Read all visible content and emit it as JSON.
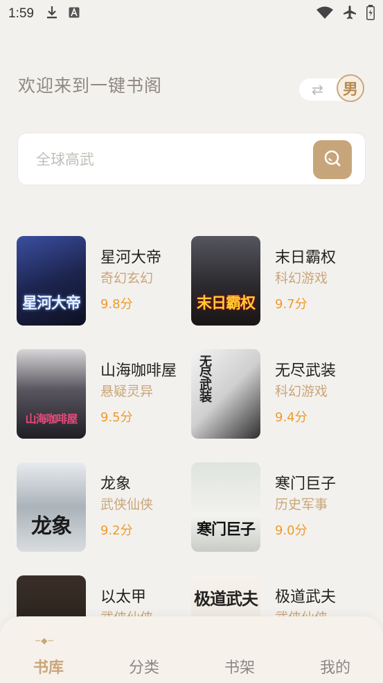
{
  "status_bar": {
    "time": "1:59"
  },
  "header": {
    "welcome": "欢迎来到一键书阁",
    "gender_label": "男",
    "swap_icon": "swap-arrows-icon"
  },
  "search": {
    "placeholder": "全球高武"
  },
  "books": [
    {
      "title": "星河大帝",
      "genre": "奇幻玄幻",
      "score": "9.8分",
      "cover_color": "#1d2550"
    },
    {
      "title": "末日霸权",
      "genre": "科幻游戏",
      "score": "9.7分",
      "cover_color": "#2b2a2e"
    },
    {
      "title": "山海咖啡屋",
      "genre": "悬疑灵异",
      "score": "9.5分",
      "cover_color": "#2e2e34"
    },
    {
      "title": "无尽武装",
      "genre": "科幻游戏",
      "score": "9.4分",
      "cover_color": "#d9d9d9"
    },
    {
      "title": "龙象",
      "genre": "武侠仙侠",
      "score": "9.2分",
      "cover_color": "#c9ced2"
    },
    {
      "title": "寒门巨子",
      "genre": "历史军事",
      "score": "9.0分",
      "cover_color": "#e3e6e2"
    },
    {
      "title": "以太甲",
      "genre": "武侠仙侠",
      "score": "",
      "cover_color": "#2b2420"
    },
    {
      "title": "极道武夫",
      "genre": "武侠仙侠",
      "score": "",
      "cover_color": "#f1ede6"
    }
  ],
  "tabs": [
    {
      "label": "书库",
      "active": true
    },
    {
      "label": "分类",
      "active": false
    },
    {
      "label": "书架",
      "active": false
    },
    {
      "label": "我的",
      "active": false
    }
  ],
  "colors": {
    "accent": "#c9a67a",
    "score": "#ee9a2a",
    "background": "#f3f1ee"
  }
}
